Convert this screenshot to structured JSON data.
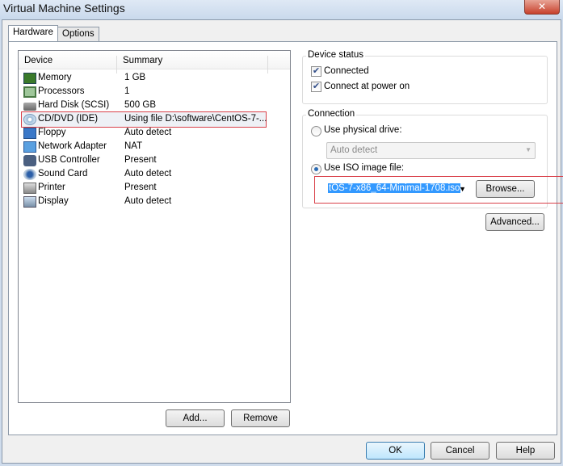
{
  "window": {
    "title": "Virtual Machine Settings",
    "close_icon": "close-icon"
  },
  "tabs": [
    {
      "label": "Hardware",
      "active": true
    },
    {
      "label": "Options",
      "active": false
    }
  ],
  "device_list": {
    "columns": [
      "Device",
      "Summary"
    ],
    "rows": [
      {
        "device": "Memory",
        "summary": "1 GB",
        "icon": "memory-icon"
      },
      {
        "device": "Processors",
        "summary": "1",
        "icon": "processor-icon"
      },
      {
        "device": "Hard Disk (SCSI)",
        "summary": "500 GB",
        "icon": "hard-disk-icon"
      },
      {
        "device": "CD/DVD (IDE)",
        "summary": "Using file D:\\software\\CentOS-7-...",
        "icon": "cd-dvd-icon",
        "selected": true
      },
      {
        "device": "Floppy",
        "summary": "Auto detect",
        "icon": "floppy-icon"
      },
      {
        "device": "Network Adapter",
        "summary": "NAT",
        "icon": "network-icon"
      },
      {
        "device": "USB Controller",
        "summary": "Present",
        "icon": "usb-icon"
      },
      {
        "device": "Sound Card",
        "summary": "Auto detect",
        "icon": "sound-icon"
      },
      {
        "device": "Printer",
        "summary": "Present",
        "icon": "printer-icon"
      },
      {
        "device": "Display",
        "summary": "Auto detect",
        "icon": "display-icon"
      }
    ],
    "add_label": "Add...",
    "remove_label": "Remove"
  },
  "device_status": {
    "title": "Device status",
    "connected": {
      "label": "Connected",
      "checked": true
    },
    "connect_power_on": {
      "label": "Connect at power on",
      "checked": true
    }
  },
  "connection": {
    "title": "Connection",
    "physical": {
      "label": "Use physical drive:",
      "selected": false
    },
    "physical_value": "Auto detect",
    "iso": {
      "label": "Use ISO image file:",
      "selected": true
    },
    "iso_value": "tOS-7-x86_64-Minimal-1708.iso",
    "browse_label": "Browse..."
  },
  "advanced_label": "Advanced...",
  "footer": {
    "ok": "OK",
    "cancel": "Cancel",
    "help": "Help"
  }
}
